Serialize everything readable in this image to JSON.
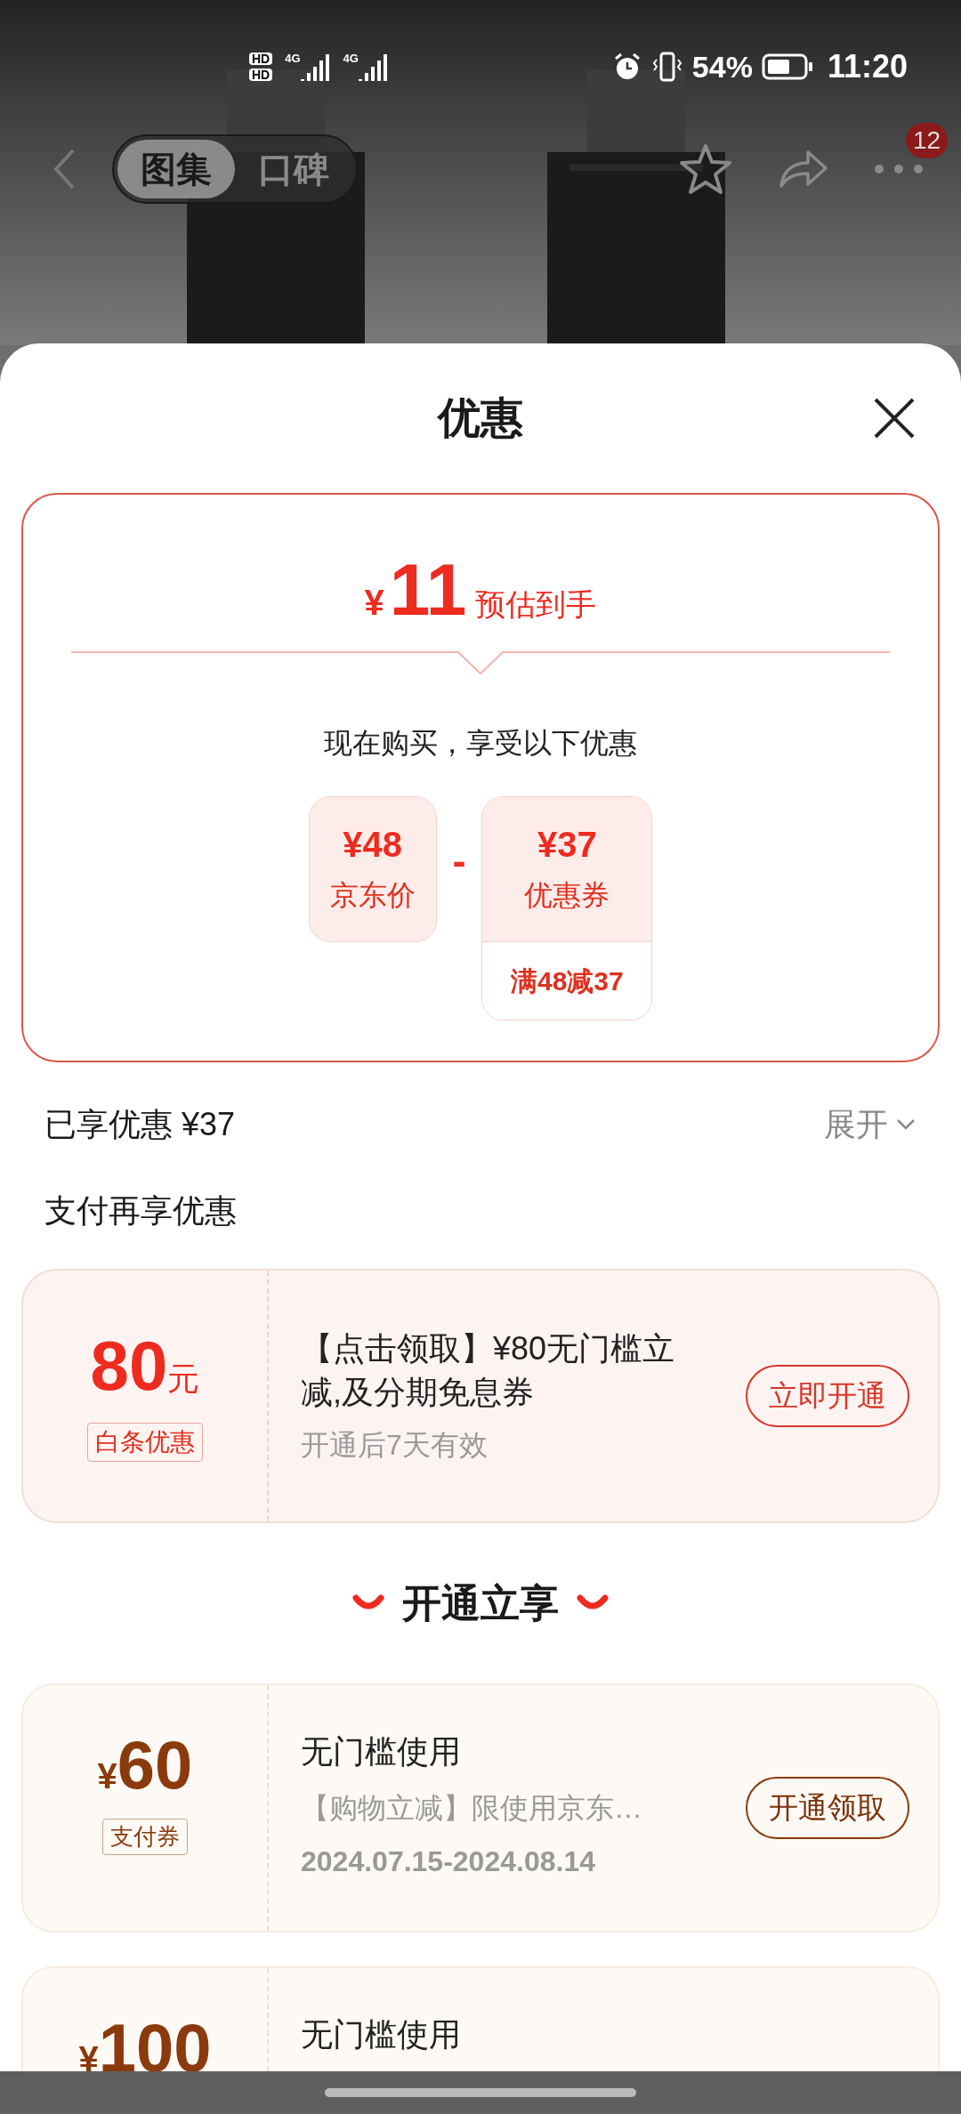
{
  "status_bar": {
    "sim_labels": [
      "HD",
      "HD"
    ],
    "network_labels": [
      "4G",
      "4G"
    ],
    "battery": "54%",
    "time": "11:20"
  },
  "top_nav": {
    "tabs": [
      {
        "label": "图集",
        "selected": true
      },
      {
        "label": "口碑",
        "selected": false
      }
    ],
    "badge": "12"
  },
  "sheet": {
    "title": "优惠"
  },
  "estimate": {
    "currency": "¥",
    "amount": "11",
    "label": "预估到手",
    "intro": "现在购买，享受以下优惠",
    "operator": "-",
    "items": [
      {
        "price": "¥48",
        "label": "京东价"
      },
      {
        "price": "¥37",
        "label": "优惠券",
        "note": "满48减37"
      }
    ]
  },
  "enjoyed": {
    "label": "已享优惠 ¥37",
    "toggle": "展开",
    "expanded": false
  },
  "pay_section": {
    "title": "支付再享优惠"
  },
  "baitiao": {
    "amount": "80",
    "unit": "元",
    "tag": "白条优惠",
    "title": "【点击领取】¥80无门槛立减,及分期免息券",
    "note": "开通后7天有效",
    "button": "立即开通"
  },
  "open_section": {
    "title": "开通立享"
  },
  "coupons": [
    {
      "currency": "¥",
      "amount": "60",
      "tag": "支付券",
      "title": "无门槛使用",
      "desc": "【购物立减】限使用京东…",
      "date": "2024.07.15-2024.08.14",
      "button": "开通领取"
    },
    {
      "currency": "¥",
      "amount": "100",
      "title": "无门槛使用"
    }
  ]
}
